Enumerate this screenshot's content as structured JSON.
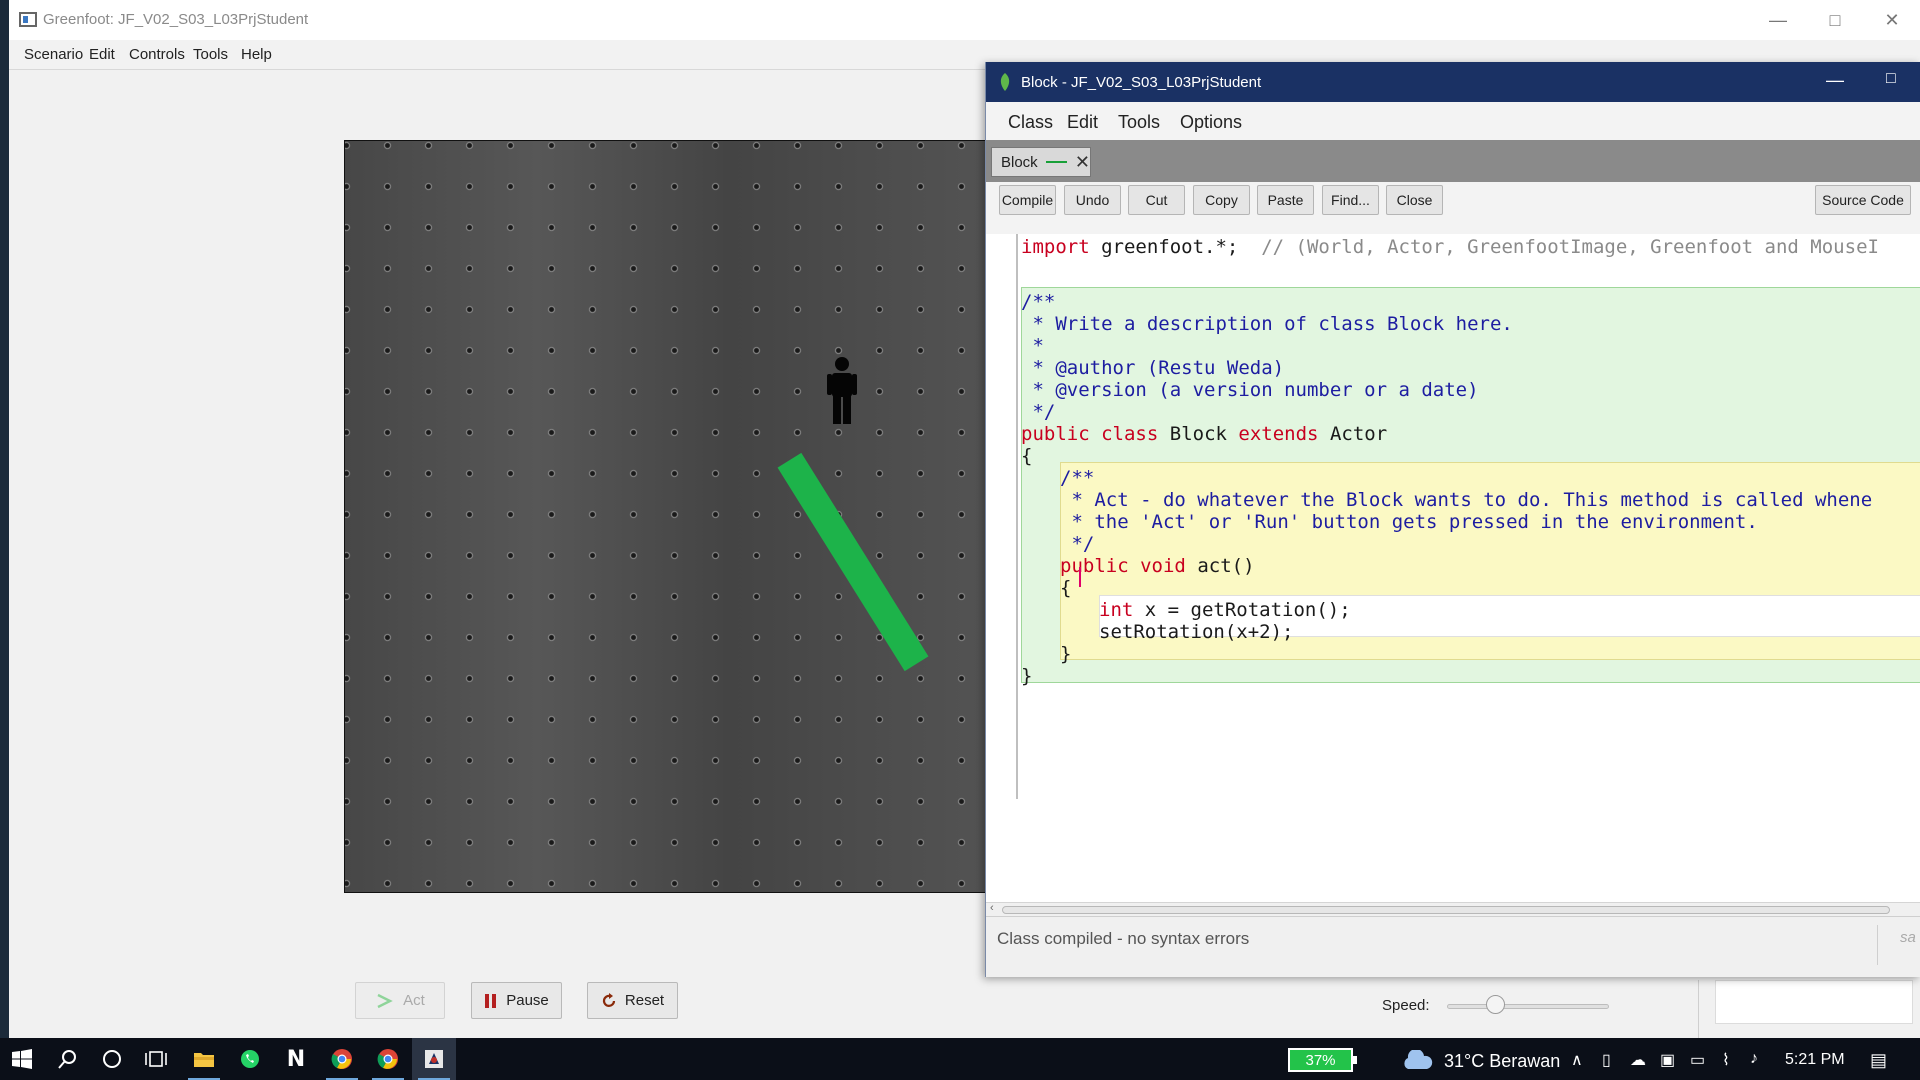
{
  "main_window": {
    "title": "Greenfoot: JF_V02_S03_L03PrjStudent",
    "menu": [
      "Scenario",
      "Edit",
      "Controls",
      "Tools",
      "Help"
    ],
    "controls": {
      "act_label": "Act",
      "pause_label": "Pause",
      "reset_label": "Reset",
      "speed_label": "Speed:",
      "speed_level": 0.3
    }
  },
  "editor": {
    "title": "Block - JF_V02_S03_L03PrjStudent",
    "menu": [
      "Class",
      "Edit",
      "Tools",
      "Options"
    ],
    "tab_label": "Block",
    "toolbar": {
      "compile": "Compile",
      "undo": "Undo",
      "cut": "Cut",
      "copy": "Copy",
      "paste": "Paste",
      "find": "Find...",
      "close": "Close",
      "view_mode": "Source Code"
    },
    "code": {
      "l1_kw": "import",
      "l1_rest": " greenfoot.*;",
      "l1_comment": "  // (World, Actor, GreenfootImage, Greenfoot and MouseI",
      "l3": "/**",
      "l4": " * Write a description of class Block here.",
      "l5": " *",
      "l6": " * @author (Restu Weda)",
      "l7": " * @version (a version number or a date)",
      "l8": " */",
      "l9_kw1": "public",
      "l9_kw2": "class",
      "l9_name": "Block",
      "l9_kw3": "extends",
      "l9_super": "Actor",
      "l10": "{",
      "l11": "/**",
      "l12": " * Act - do whatever the Block wants to do. This method is called whene",
      "l13": " * the 'Act' or 'Run' button gets pressed in the environment.",
      "l14": " */",
      "l15_kw1": "public",
      "l15_kw2": "void",
      "l15_rest": "act()",
      "l16": "{",
      "l17_kw": "int",
      "l17_rest": " x = getRotation();",
      "l18": "setRotation(x+2);",
      "l19": "}",
      "l20": "}"
    },
    "status": "Class compiled - no syntax errors",
    "status_right": "sa"
  },
  "taskbar": {
    "battery": "37%",
    "weather": "31°C  Berawan",
    "time": "5:21 PM"
  },
  "colors": {
    "editor_titlebar": "#1a3164",
    "block_actor": "#1db34a",
    "class_scope": "#e2f6e0",
    "method_scope": "#fbf9c4",
    "keyword": "#c8001f",
    "comment": "#1d1da1"
  }
}
